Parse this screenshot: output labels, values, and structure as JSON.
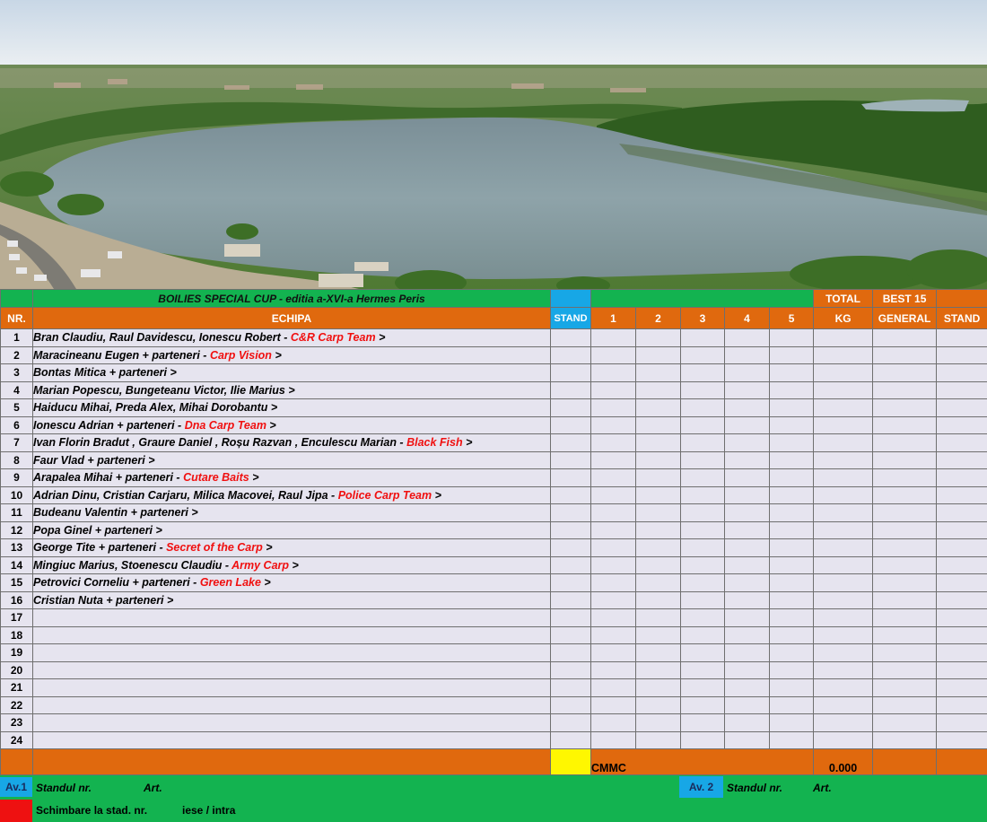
{
  "colors": {
    "green": "#13b350",
    "orange": "#e0690e",
    "blue": "#17a7e6",
    "row_bg": "#e6e4ef",
    "partner_text": "#f01010",
    "yellow": "#fff700",
    "red_box": "#ee1111"
  },
  "header": {
    "title": "BOILIES SPECIAL CUP - editia a-XVI-a Hermes Peris",
    "total": "TOTAL",
    "best15": "BEST 15",
    "nr": "NR.",
    "echipa": "ECHIPA",
    "stand": "STAND",
    "days": [
      "1",
      "2",
      "3",
      "4",
      "5"
    ],
    "kg": "KG",
    "general": "GENERAL",
    "stand2": "STAND"
  },
  "rows": [
    {
      "nr": "1",
      "name": "Bran Claudiu, Raul Davidescu, Ionescu Robert -",
      "team": "C&R Carp Team",
      "arrow": ">"
    },
    {
      "nr": "2",
      "name": "Maracineanu Eugen + parteneri -",
      "team": "Carp Vision",
      "arrow": ">"
    },
    {
      "nr": "3",
      "name": "Bontas Mitica + parteneri",
      "team": "",
      "arrow": ">"
    },
    {
      "nr": "4",
      "name": "Marian Popescu, Bungeteanu Victor, Ilie Marius",
      "team": "",
      "arrow": ">"
    },
    {
      "nr": "5",
      "name": "Haiducu Mihai, Preda Alex, Mihai Dorobantu",
      "team": "",
      "arrow": ">"
    },
    {
      "nr": "6",
      "name": "Ionescu Adrian + parteneri -",
      "team": "Dna Carp Team",
      "arrow": ">"
    },
    {
      "nr": "7",
      "name": "Ivan Florin Bradut , Graure Daniel , Roșu Razvan , Enculescu Marian -",
      "team": "Black Fish",
      "arrow": ">"
    },
    {
      "nr": "8",
      "name": "Faur Vlad + parteneri",
      "team": "",
      "arrow": ">"
    },
    {
      "nr": "9",
      "name": "Arapalea Mihai + parteneri -",
      "team": "Cutare Baits",
      "arrow": ">"
    },
    {
      "nr": "10",
      "name": "Adrian Dinu, Cristian Carjaru, Milica Macovei, Raul Jipa -",
      "team": "Police Carp Team",
      "arrow": ">"
    },
    {
      "nr": "11",
      "name": "Budeanu Valentin + parteneri",
      "team": "",
      "arrow": ">"
    },
    {
      "nr": "12",
      "name": "Popa Ginel + parteneri",
      "team": "",
      "arrow": ">"
    },
    {
      "nr": "13",
      "name": "George Tite + parteneri -",
      "team": "Secret of the Carp",
      "arrow": ">"
    },
    {
      "nr": "14",
      "name": "Mingiuc Marius, Stoenescu Claudiu -",
      "team": "Army Carp",
      "arrow": ">"
    },
    {
      "nr": "15",
      "name": "Petrovici Corneliu + parteneri -",
      "team": "Green Lake",
      "arrow": ">"
    },
    {
      "nr": "16",
      "name": "Cristian Nuta + parteneri",
      "team": "",
      "arrow": ">"
    },
    {
      "nr": "17",
      "name": "",
      "team": "",
      "arrow": ""
    },
    {
      "nr": "18",
      "name": "",
      "team": "",
      "arrow": ""
    },
    {
      "nr": "19",
      "name": "",
      "team": "",
      "arrow": ""
    },
    {
      "nr": "20",
      "name": "",
      "team": "",
      "arrow": ""
    },
    {
      "nr": "21",
      "name": "",
      "team": "",
      "arrow": ""
    },
    {
      "nr": "22",
      "name": "",
      "team": "",
      "arrow": ""
    },
    {
      "nr": "23",
      "name": "",
      "team": "",
      "arrow": ""
    },
    {
      "nr": "24",
      "name": "",
      "team": "",
      "arrow": ""
    }
  ],
  "totals": {
    "cmmc": "CMMC",
    "value": "0.000"
  },
  "footer": {
    "av1": "Av.1",
    "av1_standul": "Standul nr.",
    "av1_art": "Art.",
    "av2": "Av. 2",
    "av2_standul": "Standul  nr.",
    "av2_art": "Art.",
    "schimbare": "Schimbare la stad.  nr.",
    "iese": "iese / intra"
  }
}
